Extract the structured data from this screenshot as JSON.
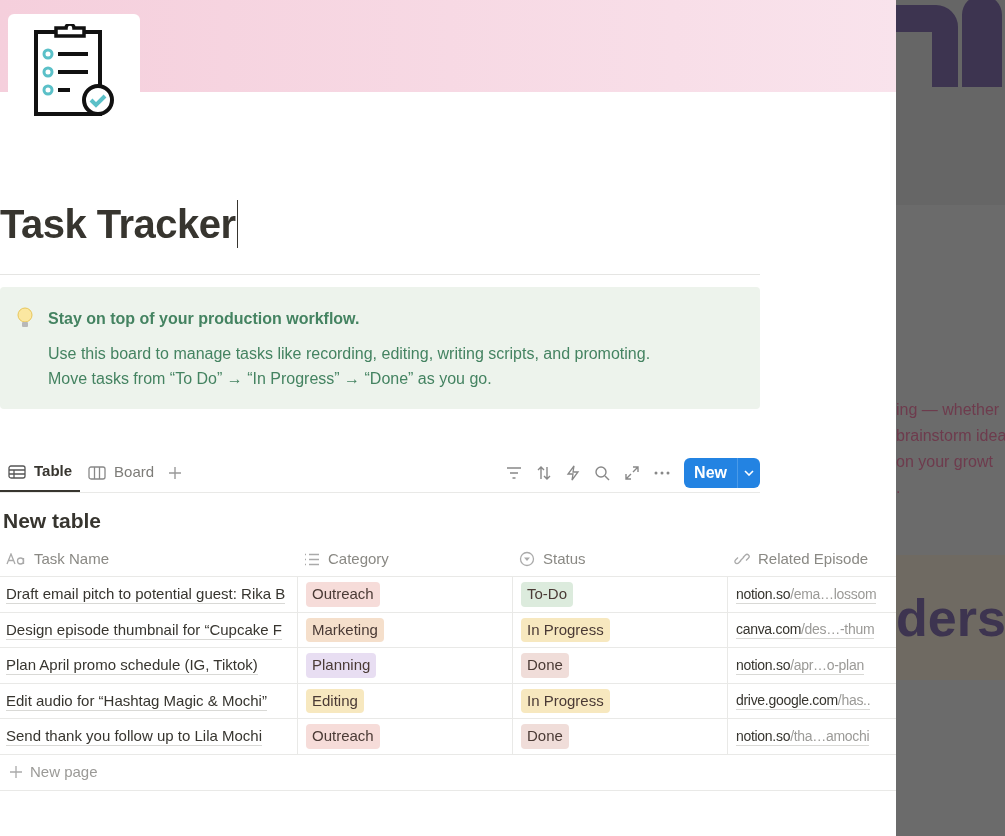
{
  "page": {
    "title": "Task Tracker"
  },
  "callout": {
    "heading": "Stay on top of your production workflow.",
    "lines": [
      "Use this board to manage tasks like recording, editing, writing scripts, and promoting.",
      "Move tasks from “To Do” → “In Progress” → “Done” as you go."
    ]
  },
  "views": [
    {
      "label": "Table",
      "kind": "table",
      "selected": true
    },
    {
      "label": "Board",
      "kind": "board",
      "selected": false
    }
  ],
  "new_button": {
    "label": "New"
  },
  "table": {
    "title": "New table",
    "columns": [
      {
        "label": "Task Name",
        "kind": "title"
      },
      {
        "label": "Category",
        "kind": "select"
      },
      {
        "label": "Status",
        "kind": "status"
      },
      {
        "label": "Related Episode",
        "kind": "url"
      }
    ],
    "rows": [
      {
        "task": "Draft email pitch to potential guest: Rika B",
        "category": {
          "label": "Outreach",
          "color": "#f6dcd9"
        },
        "status": {
          "label": "To-Do",
          "color": "#dcebdd"
        },
        "link": {
          "domain": "notion.so",
          "path": "/ema…lossom"
        }
      },
      {
        "task": "Design episode thumbnail for “Cupcake F",
        "category": {
          "label": "Marketing",
          "color": "#f5dfcb"
        },
        "status": {
          "label": "In Progress",
          "color": "#f7e8bf"
        },
        "link": {
          "domain": "canva.com",
          "path": "/des…-thum"
        }
      },
      {
        "task": "Plan April promo schedule (IG, Tiktok)",
        "category": {
          "label": "Planning",
          "color": "#e8def2"
        },
        "status": {
          "label": "Done",
          "color": "#f0ddd9"
        },
        "link": {
          "domain": "notion.so",
          "path": "/apr…o-plan"
        }
      },
      {
        "task": "Edit audio for “Hashtag Magic & Mochi”",
        "category": {
          "label": "Editing",
          "color": "#f7e8bf"
        },
        "status": {
          "label": "In Progress",
          "color": "#f7e8bf"
        },
        "link": {
          "domain": "drive.google.com",
          "path": "/has.."
        }
      },
      {
        "task": "Send thank you follow up to Lila Mochi",
        "category": {
          "label": "Outreach",
          "color": "#f6dcd9"
        },
        "status": {
          "label": "Done",
          "color": "#f0ddd9"
        },
        "link": {
          "domain": "notion.so",
          "path": "/tha…amochi"
        }
      }
    ],
    "new_row": "New page"
  },
  "background_page": {
    "lines": [
      "ing — whether",
      "brainstorm idea",
      "on your growt",
      "."
    ],
    "banner": "ders"
  }
}
